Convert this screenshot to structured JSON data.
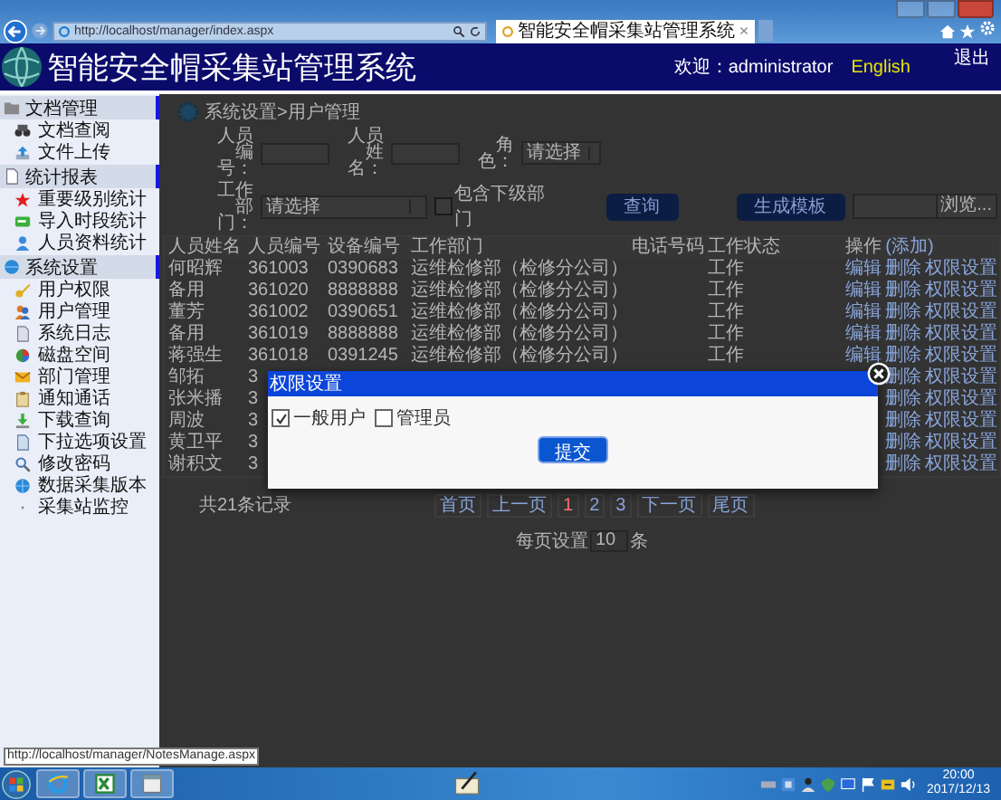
{
  "browser": {
    "address": "http://localhost/manager/index.aspx",
    "tab_title": "智能安全帽采集站管理系统"
  },
  "header": {
    "title": "智能安全帽采集站管理系统",
    "welcome": "欢迎：administrator",
    "language": "English",
    "logout": "退出"
  },
  "sidebar": {
    "groups": [
      {
        "title": "文档管理",
        "items": [
          {
            "label": "文档查阅"
          },
          {
            "label": "文件上传"
          }
        ]
      },
      {
        "title": "统计报表",
        "items": [
          {
            "label": "重要级别统计"
          },
          {
            "label": "导入时段统计"
          },
          {
            "label": "人员资料统计"
          }
        ]
      },
      {
        "title": "系统设置",
        "items": [
          {
            "label": "用户权限"
          },
          {
            "label": "用户管理"
          },
          {
            "label": "系统日志"
          },
          {
            "label": "磁盘空间"
          },
          {
            "label": "部门管理"
          },
          {
            "label": "通知通话"
          },
          {
            "label": "下载查询"
          },
          {
            "label": "下拉选项设置"
          },
          {
            "label": "修改密码"
          },
          {
            "label": "数据采集版本"
          },
          {
            "label": "采集站监控"
          }
        ]
      }
    ]
  },
  "breadcrumb": "系统设置>用户管理",
  "filters": {
    "fields": [
      {
        "label": "人员编号：",
        "kind": "input"
      },
      {
        "label": "人员姓名：",
        "kind": "input"
      },
      {
        "label": "角色：",
        "kind": "select",
        "value": "请选择"
      }
    ],
    "department": {
      "label": "工作部门：",
      "value": "请选择"
    },
    "include_sub": {
      "label": "包含下级部门",
      "checked": false
    },
    "buttons": [
      "查询",
      "生成模板"
    ],
    "file_button": "浏览..."
  },
  "table": {
    "columns": [
      "人员姓名",
      "人员编号",
      "设备编号",
      "工作部门",
      "电话号码",
      "工作状态",
      "操作"
    ],
    "add_link": "(添加)",
    "rows": [
      {
        "name": "何昭辉",
        "number": "361003",
        "device": "0390683",
        "dept": "运维检修部（检修分公司）",
        "status": "工作",
        "actions": [
          "编辑",
          "删除",
          "权限设置"
        ]
      },
      {
        "name": "备用",
        "number": "361020",
        "device": "8888888",
        "dept": "运维检修部（检修分公司）",
        "status": "工作",
        "actions": [
          "编辑",
          "删除",
          "权限设置"
        ]
      },
      {
        "name": "董芳",
        "number": "361002",
        "device": "0390651",
        "dept": "运维检修部（检修分公司）",
        "status": "工作",
        "actions": [
          "编辑",
          "删除",
          "权限设置"
        ]
      },
      {
        "name": "备用",
        "number": "361019",
        "device": "8888888",
        "dept": "运维检修部（检修分公司）",
        "status": "工作",
        "actions": [
          "编辑",
          "删除",
          "权限设置"
        ]
      },
      {
        "name": "蒋强生",
        "number": "361018",
        "device": "0391245",
        "dept": "运维检修部（检修分公司）",
        "status": "工作",
        "actions": [
          "编辑",
          "删除",
          "权限设置"
        ]
      },
      {
        "name": "邹拓",
        "number": "3",
        "actions": [
          "删除",
          "权限设置"
        ]
      },
      {
        "name": "张米播",
        "number": "3",
        "actions": [
          "删除",
          "权限设置"
        ]
      },
      {
        "name": "周波",
        "number": "3",
        "actions": [
          "删除",
          "权限设置"
        ]
      },
      {
        "name": "黄卫平",
        "number": "3",
        "actions": [
          "删除",
          "权限设置"
        ]
      },
      {
        "name": "谢积文",
        "number": "3",
        "actions": [
          "删除",
          "权限设置"
        ]
      }
    ]
  },
  "pagination": {
    "total": "共21条记录",
    "pages": [
      {
        "label": "首页",
        "selected": false
      },
      {
        "label": "上一页",
        "selected": false
      },
      {
        "label": "1",
        "selected": true
      },
      {
        "label": "2",
        "selected": false
      },
      {
        "label": "3",
        "selected": false
      },
      {
        "label": "下一页",
        "selected": false
      },
      {
        "label": "尾页",
        "selected": false
      }
    ],
    "page_size_label": "每页设置",
    "page_size": "10",
    "page_size_unit": "条"
  },
  "dialog": {
    "title": "权限设置",
    "options": [
      {
        "label": "一般用户",
        "checked": true
      },
      {
        "label": "管理员",
        "checked": false
      }
    ],
    "submit": "提交"
  },
  "status_tooltip": "http://localhost/manager/NotesManage.aspx",
  "taskbar": {
    "time": "20:00",
    "date": "2017/12/13"
  }
}
